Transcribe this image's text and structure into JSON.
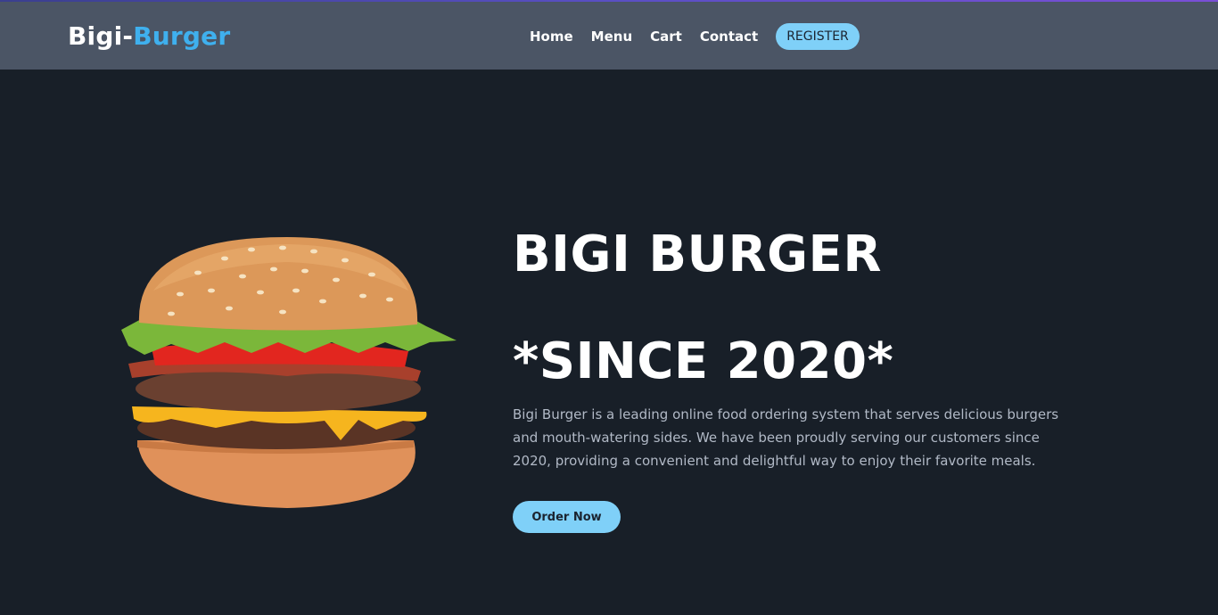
{
  "header": {
    "brand_main": "Bigi-",
    "brand_accent": "Burger",
    "nav": [
      "Home",
      "Menu",
      "Cart",
      "Contact"
    ],
    "register_label": "REGISTER"
  },
  "hero": {
    "title": "BIGI BURGER",
    "subtitle": "*SINCE 2020*",
    "description": "Bigi Burger is a leading online food ordering system that serves delicious burgers and mouth-watering sides. We have been proudly serving our customers since 2020, providing a convenient and delightful way to enjoy their favorite meals.",
    "cta_label": "Order Now"
  },
  "colors": {
    "header_bg": "#4b5565",
    "page_bg": "#181f28",
    "accent": "#3fb0ee",
    "button_bg": "#7fd0f8"
  }
}
